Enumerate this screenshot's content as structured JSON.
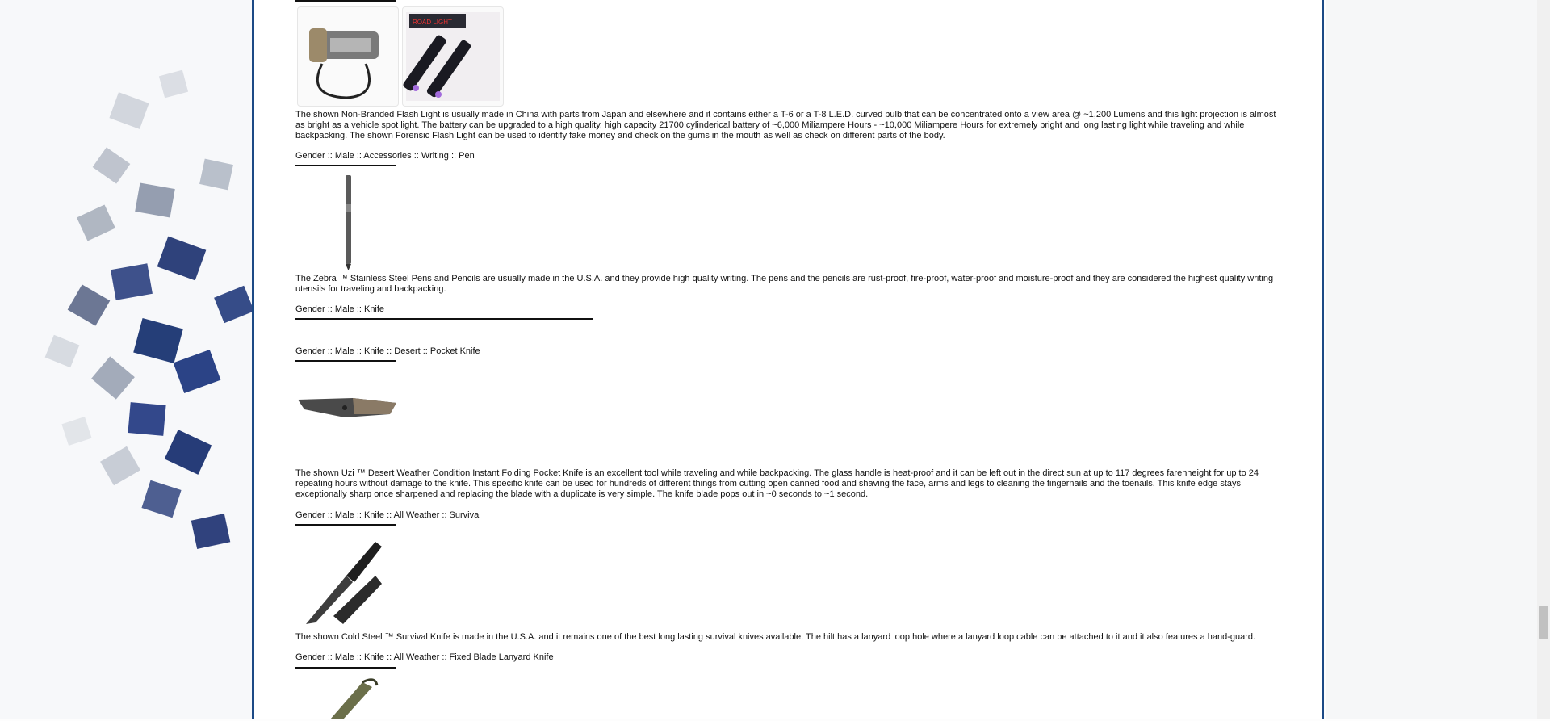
{
  "sections": [
    {
      "paragraph": "The shown Non-Branded Flash Light is usually made in China with parts from Japan and elsewhere and it contains either a T-6 or a T-8 L.E.D. curved bulb that can be concentrated onto a view area @ ~1,200 Lumens and this light projection is almost as bright as a vehicle spot light. The battery can be upgraded to a high quality, high capacity 21700 cylinderical battery of ~6,000 Miliampere Hours - ~10,000 Miliampere Hours for extremely bright and long lasting light while traveling and while backpacking. The shown Forensic Flash Light can be used to identify fake money and check on the gums in the mouth as well as check on different parts of the body.",
      "image_labels": [
        "ROAD LIGHT"
      ]
    },
    {
      "heading": "Gender :: Male :: Accessories :: Writing :: Pen",
      "paragraph": "The Zebra ™ Stainless Steel Pens and Pencils are usually made in the U.S.A. and they provide high quality writing. The pens and the pencils are rust-proof, fire-proof, water-proof and moisture-proof and they are considered the highest quality writing utensils for traveling and backpacking."
    },
    {
      "heading": "Gender :: Male :: Knife"
    },
    {
      "heading": "Gender :: Male :: Knife :: Desert :: Pocket Knife",
      "paragraph": "The shown Uzi ™ Desert Weather Condition Instant Folding Pocket Knife is an excellent tool while traveling and while backpacking. The glass handle is heat-proof and it can be left out in the direct sun at up to 117 degrees farenheight for up to 24 repeating hours without damage to the knife. This specific knife can be used for hundreds of different things from cutting open canned food and shaving the face, arms and legs to cleaning the fingernails and the toenails. This knife edge stays exceptionally sharp once sharpened and replacing the blade with a duplicate is very simple. The knife blade pops out in ~0 seconds to ~1 second."
    },
    {
      "heading": "Gender :: Male :: Knife :: All Weather :: Survival",
      "paragraph": "The shown Cold Steel ™ Survival Knife is made in the U.S.A. and it remains one of the best long lasting survival knives available. The hilt has a lanyard loop hole where a lanyard loop cable can be attached to it and it also features a hand-guard."
    },
    {
      "heading": "Gender :: Male :: Knife :: All Weather :: Fixed Blade Lanyard Knife"
    }
  ],
  "colors": {
    "panel_border": "#1c4a86",
    "accent_blue": "#0f2a6b",
    "rule": "#111111"
  }
}
